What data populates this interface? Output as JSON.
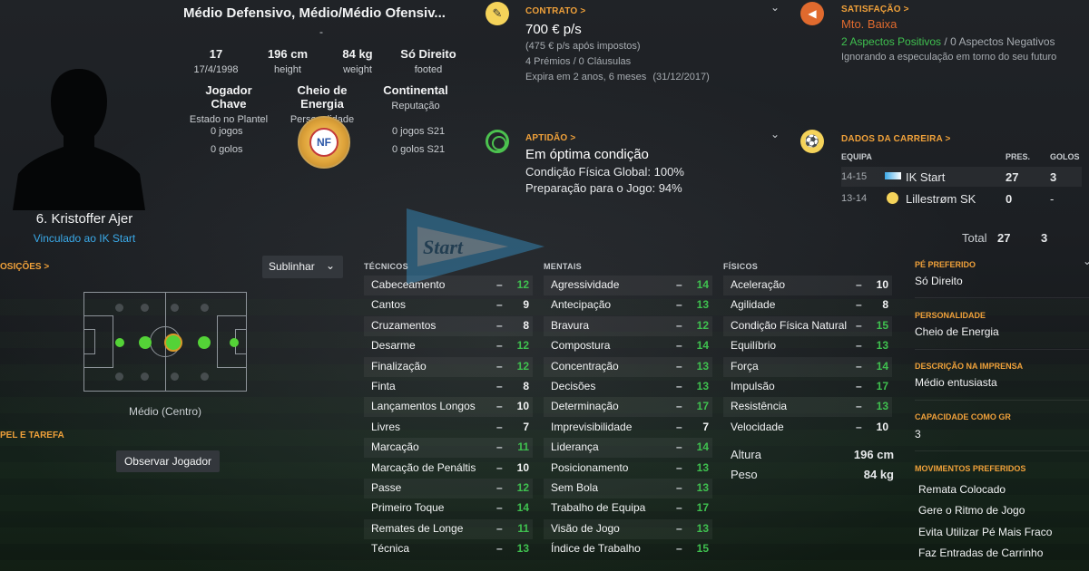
{
  "colors": {
    "accent_orange": "#f0a13a",
    "attr_green": "#3fc04f",
    "link_blue": "#3aa9e8",
    "positive_green": "#3fc04f",
    "negative_orange": "#e06a2e"
  },
  "profile": {
    "name": "6. Kristoffer Ajer",
    "club_link": "Vinculado ao IK Start",
    "positions_title": "Médio Defensivo, Médio/Médio Ofensiv...",
    "dash": "-",
    "age": {
      "value": "17",
      "label": "17/4/1998"
    },
    "height": {
      "value": "196 cm",
      "label": "height"
    },
    "weight": {
      "value": "84 kg",
      "label": "weight"
    },
    "foot": {
      "value": "Só Direito",
      "label": "footed"
    },
    "status": {
      "value": "Jogador Chave",
      "label": "Estado no Plantel"
    },
    "personality": {
      "value": "Cheio de Energia",
      "label": "Personalidade"
    },
    "reputation": {
      "value": "Continental",
      "label": "Reputação"
    },
    "caps": "0 jogos",
    "goals": "0 golos",
    "caps_u21": "0 jogos S21",
    "goals_u21": "0 golos S21",
    "federation_badge_text": "NF"
  },
  "contract": {
    "title": "CONTRATO >",
    "wage": "700 € p/s",
    "after_tax": "(475 € p/s após impostos)",
    "bonuses": "4 Prémios / 0 Cláusulas",
    "expires": "Expira em 2 anos, 6 meses",
    "expires_date": "(31/12/2017)"
  },
  "satisfaction": {
    "title": "SATISFAÇÃO >",
    "value": "Mto. Baixa",
    "positives": "2 Aspectos Positivos",
    "separator": "/",
    "negatives": "0 Aspectos Negativos",
    "note": "Ignorando a especulação em torno do seu futuro"
  },
  "fitness": {
    "title": "APTIDÃO >",
    "state": "Em óptima condição",
    "overall": "Condição Física Global: 100%",
    "match": "Preparação para o Jogo: 94%"
  },
  "career": {
    "title": "DADOS DA CARREIRA >",
    "headers": [
      "EQUIPA",
      "PRES.",
      "GOLOS"
    ],
    "rows": [
      {
        "season": "14-15",
        "team": "IK Start",
        "apps": "27",
        "goals": "3"
      },
      {
        "season": "13-14",
        "team": "Lillestrøm SK",
        "apps": "0",
        "goals": "-"
      }
    ],
    "total_label": "Total",
    "total_apps": "27",
    "total_goals": "3"
  },
  "watermark_text": "Start",
  "positions": {
    "title": "OSIÇÕES >",
    "dropdown": "Sublinhar",
    "current": "Médio (Centro)",
    "role_title": "PEL E TAREFA",
    "observe_button": "Observar Jogador"
  },
  "attributes": {
    "technical_title": "TÉCNICOS",
    "mental_title": "MENTAIS",
    "physical_title": "FÍSICOS",
    "dash": "–",
    "technical": [
      {
        "name": "Cabeceamento",
        "value": "12",
        "color": "#3fc04f"
      },
      {
        "name": "Cantos",
        "value": "9",
        "color": "#f2f3f4"
      },
      {
        "name": "Cruzamentos",
        "value": "8",
        "color": "#f2f3f4"
      },
      {
        "name": "Desarme",
        "value": "12",
        "color": "#3fc04f"
      },
      {
        "name": "Finalização",
        "value": "12",
        "color": "#3fc04f"
      },
      {
        "name": "Finta",
        "value": "8",
        "color": "#f2f3f4"
      },
      {
        "name": "Lançamentos Longos",
        "value": "10",
        "color": "#f2f3f4"
      },
      {
        "name": "Livres",
        "value": "7",
        "color": "#f2f3f4"
      },
      {
        "name": "Marcação",
        "value": "11",
        "color": "#3fc04f"
      },
      {
        "name": "Marcação de Penáltis",
        "value": "10",
        "color": "#f2f3f4"
      },
      {
        "name": "Passe",
        "value": "12",
        "color": "#3fc04f"
      },
      {
        "name": "Primeiro Toque",
        "value": "14",
        "color": "#3fc04f"
      },
      {
        "name": "Remates de Longe",
        "value": "11",
        "color": "#3fc04f"
      },
      {
        "name": "Técnica",
        "value": "13",
        "color": "#3fc04f"
      }
    ],
    "mental": [
      {
        "name": "Agressividade",
        "value": "14",
        "color": "#3fc04f"
      },
      {
        "name": "Antecipação",
        "value": "13",
        "color": "#3fc04f"
      },
      {
        "name": "Bravura",
        "value": "12",
        "color": "#3fc04f"
      },
      {
        "name": "Compostura",
        "value": "14",
        "color": "#3fc04f"
      },
      {
        "name": "Concentração",
        "value": "13",
        "color": "#3fc04f"
      },
      {
        "name": "Decisões",
        "value": "13",
        "color": "#3fc04f"
      },
      {
        "name": "Determinação",
        "value": "17",
        "color": "#3fc04f"
      },
      {
        "name": "Imprevisibilidade",
        "value": "7",
        "color": "#f2f3f4"
      },
      {
        "name": "Liderança",
        "value": "14",
        "color": "#3fc04f"
      },
      {
        "name": "Posicionamento",
        "value": "13",
        "color": "#3fc04f"
      },
      {
        "name": "Sem Bola",
        "value": "13",
        "color": "#3fc04f"
      },
      {
        "name": "Trabalho de Equipa",
        "value": "17",
        "color": "#3fc04f"
      },
      {
        "name": "Visão de Jogo",
        "value": "13",
        "color": "#3fc04f"
      },
      {
        "name": "Índice de Trabalho",
        "value": "15",
        "color": "#3fc04f"
      }
    ],
    "physical": [
      {
        "name": "Aceleração",
        "value": "10",
        "color": "#f2f3f4"
      },
      {
        "name": "Agilidade",
        "value": "8",
        "color": "#f2f3f4"
      },
      {
        "name": "Condição Física Natural",
        "value": "15",
        "color": "#3fc04f"
      },
      {
        "name": "Equilíbrio",
        "value": "13",
        "color": "#3fc04f"
      },
      {
        "name": "Força",
        "value": "14",
        "color": "#3fc04f"
      },
      {
        "name": "Impulsão",
        "value": "17",
        "color": "#3fc04f"
      },
      {
        "name": "Resistência",
        "value": "13",
        "color": "#3fc04f"
      },
      {
        "name": "Velocidade",
        "value": "10",
        "color": "#f2f3f4"
      }
    ],
    "height_label": "Altura",
    "height_value": "196 cm",
    "weight_label": "Peso",
    "weight_value": "84 kg"
  },
  "sidebar": {
    "foot_title": "PÉ PREFERIDO",
    "foot_value": "Só Direito",
    "personality_title": "PERSONALIDADE",
    "personality_value": "Cheio de Energia",
    "media_title": "DESCRIÇÃO NA IMPRENSA",
    "media_value": "Médio entusiasta",
    "gk_title": "CAPACIDADE COMO GR",
    "gk_value": "3",
    "moves_title": "MOVIMENTOS PREFERIDOS",
    "moves": [
      "Remata Colocado",
      "Gere o Ritmo de Jogo",
      "Evita Utilizar Pé Mais Fraco",
      "Faz Entradas de Carrinho"
    ]
  }
}
